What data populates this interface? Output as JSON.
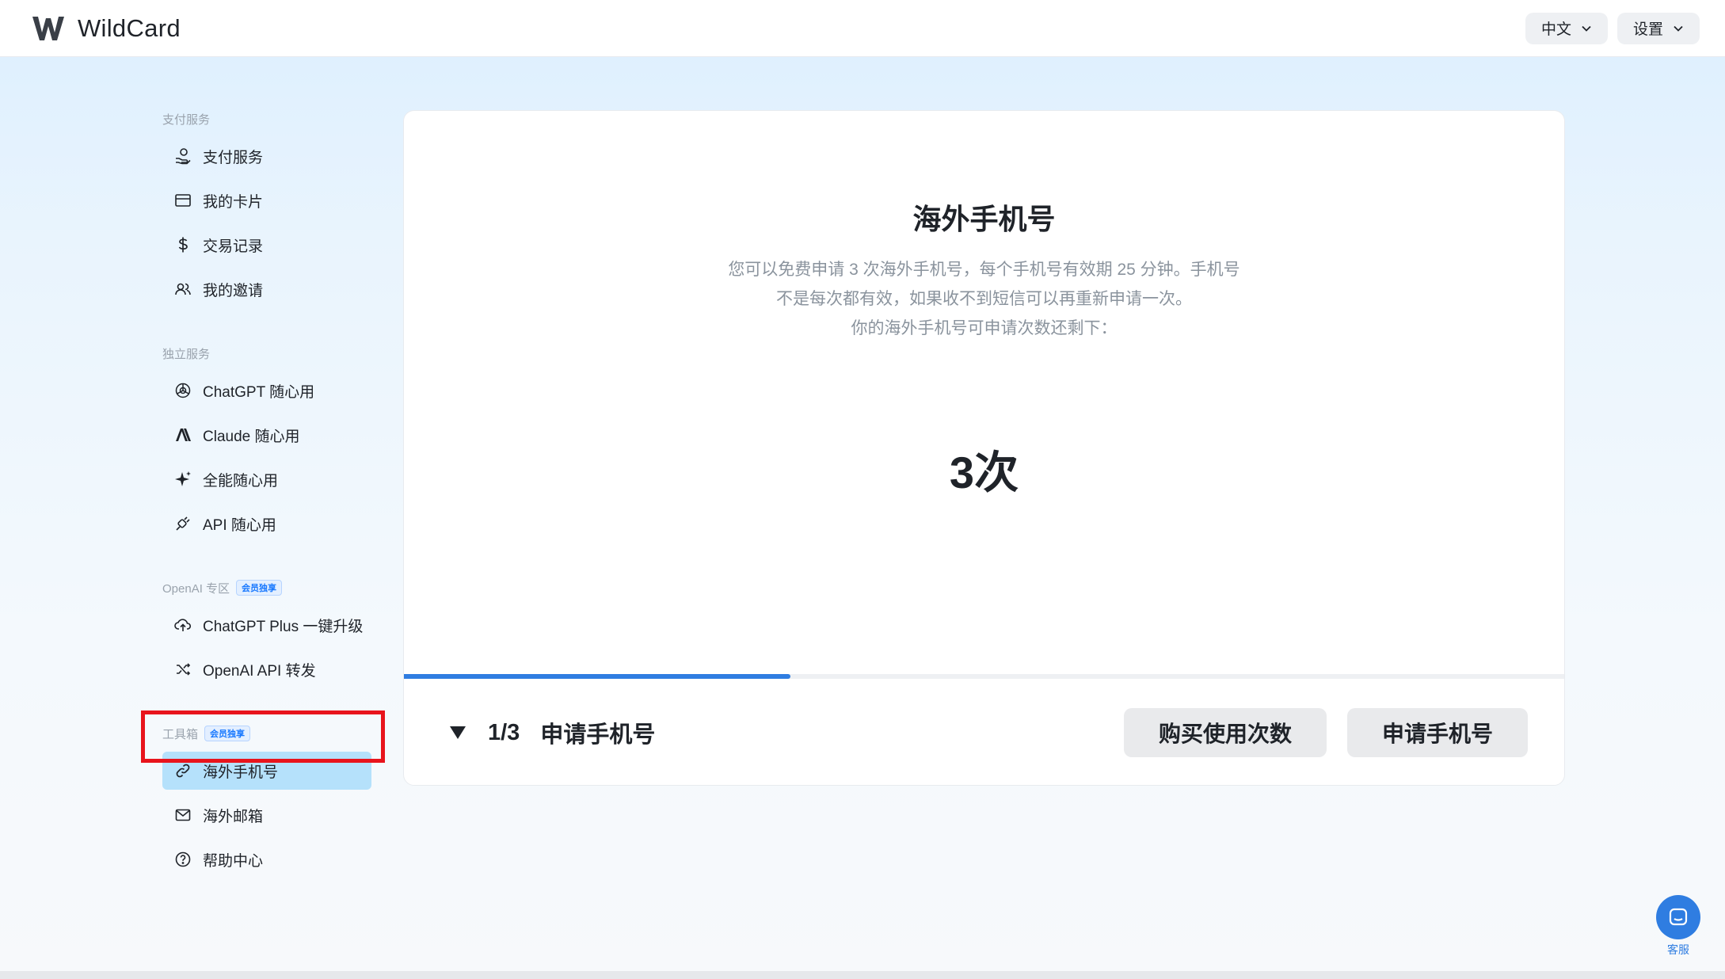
{
  "header": {
    "brand": "WildCard",
    "language": "中文",
    "settings": "设置"
  },
  "sidebar": {
    "groups": [
      {
        "label": "支付服务",
        "badge": "",
        "items": [
          "支付服务",
          "我的卡片",
          "交易记录",
          "我的邀请"
        ]
      },
      {
        "label": "独立服务",
        "badge": "",
        "items": [
          "ChatGPT 随心用",
          "Claude 随心用",
          "全能随心用",
          "API 随心用"
        ]
      },
      {
        "label": "OpenAI 专区",
        "badge": "会员独享",
        "items": [
          "ChatGPT Plus 一键升级",
          "OpenAI API 转发"
        ]
      },
      {
        "label": "工具箱",
        "badge": "会员独享",
        "items": [
          "海外手机号",
          "海外邮箱",
          "帮助中心"
        ]
      }
    ],
    "active_item": "海外手机号"
  },
  "main": {
    "title": "海外手机号",
    "desc_line1": "您可以免费申请 3 次海外手机号，每个手机号有效期 25 分钟。手机号",
    "desc_line2": "不是每次都有效，如果收不到短信可以再重新申请一次。",
    "desc_line3": "你的海外手机号可申请次数还剩下：",
    "remaining": "3次",
    "progress_fraction": 0.333,
    "step_counter": "1/3",
    "step_label": "申请手机号",
    "buy_button": "购买使用次数",
    "apply_button": "申请手机号"
  },
  "support": {
    "label": "客服"
  },
  "colors": {
    "accent": "#2f7de1",
    "active_bg": "#b5e1fb",
    "highlight": "#e8141c"
  }
}
